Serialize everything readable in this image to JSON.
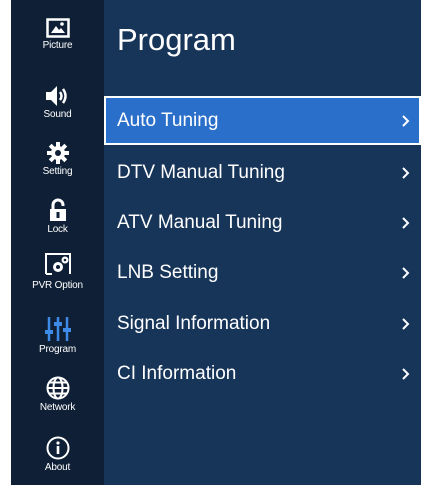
{
  "sidebar": {
    "items": [
      {
        "label": "Picture",
        "icon": "picture-icon"
      },
      {
        "label": "Sound",
        "icon": "speaker-icon"
      },
      {
        "label": "Setting",
        "icon": "gear-icon"
      },
      {
        "label": "Lock",
        "icon": "lock-icon"
      },
      {
        "label": "PVR Option",
        "icon": "pvr-icon"
      },
      {
        "label": "Program",
        "icon": "program-sliders-icon",
        "active": true
      },
      {
        "label": "Network",
        "icon": "globe-icon"
      },
      {
        "label": "About",
        "icon": "info-icon"
      }
    ]
  },
  "main": {
    "title": "Program",
    "selected_index": 0,
    "items": [
      {
        "label": "Auto Tuning"
      },
      {
        "label": "DTV Manual Tuning"
      },
      {
        "label": "ATV Manual Tuning"
      },
      {
        "label": "LNB Setting"
      },
      {
        "label": "Signal Information"
      },
      {
        "label": "CI Information"
      }
    ]
  },
  "colors": {
    "sidebar_bg": "#0f2036",
    "panel_bg": "#173459",
    "highlight": "#2a6fc9",
    "text": "#ffffff"
  }
}
